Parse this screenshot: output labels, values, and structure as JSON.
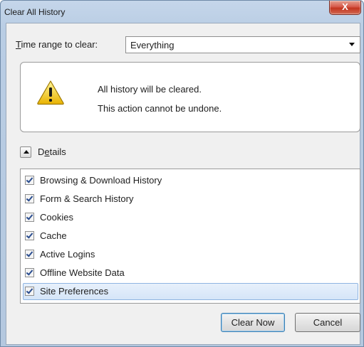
{
  "window": {
    "title": "Clear All History",
    "close_glyph": "X"
  },
  "time_range": {
    "label_accel": "T",
    "label_rest": "ime range to clear:",
    "selected": "Everything"
  },
  "warning": {
    "icon": "warning-triangle-icon",
    "line1": "All history will be cleared.",
    "line2": "This action cannot be undone."
  },
  "details": {
    "label_pre": "D",
    "label_accel": "e",
    "label_post": "tails",
    "items": [
      {
        "label": "Browsing & Download History",
        "checked": true
      },
      {
        "label": "Form & Search History",
        "checked": true
      },
      {
        "label": "Cookies",
        "checked": true
      },
      {
        "label": "Cache",
        "checked": true
      },
      {
        "label": "Active Logins",
        "checked": true
      },
      {
        "label": "Offline Website Data",
        "checked": true
      },
      {
        "label": "Site Preferences",
        "checked": true,
        "selected": true
      }
    ]
  },
  "buttons": {
    "clear_now": "Clear Now",
    "cancel": "Cancel"
  },
  "colors": {
    "accent_selection": "#d5e5f8",
    "warning_yellow": "#f6d23a"
  }
}
